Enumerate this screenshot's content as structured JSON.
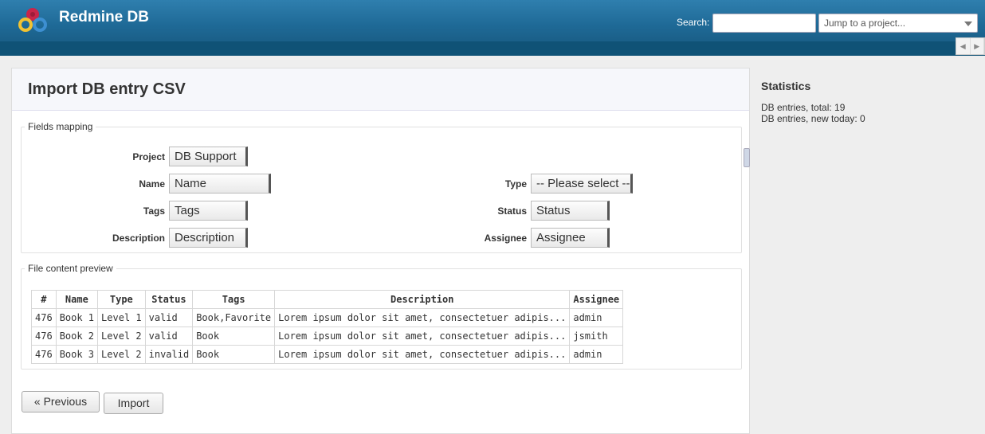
{
  "header": {
    "app_title": "Redmine DB",
    "search_label": "Search:",
    "search_value": "",
    "project_jump": "Jump to a project..."
  },
  "page": {
    "title": "Import DB entry CSV"
  },
  "mapping": {
    "legend": "Fields mapping",
    "left": [
      {
        "label": "Project",
        "value": "DB Support"
      },
      {
        "label": "Name",
        "value": "Name"
      },
      {
        "label": "Tags",
        "value": "Tags"
      },
      {
        "label": "Description",
        "value": "Description"
      }
    ],
    "right": [
      {
        "label": "Type",
        "value": "-- Please select --"
      },
      {
        "label": "Status",
        "value": "Status"
      },
      {
        "label": "Assignee",
        "value": "Assignee"
      }
    ]
  },
  "preview": {
    "legend": "File content preview",
    "columns": [
      "#",
      "Name",
      "Type",
      "Status",
      "Tags",
      "Description",
      "Assignee"
    ],
    "rows": [
      [
        "476",
        "Book 1",
        "Level 1",
        "valid",
        "Book,Favorite",
        "Lorem ipsum dolor sit amet, consectetuer adipis...",
        "admin"
      ],
      [
        "476",
        "Book 2",
        "Level 2",
        "valid",
        "Book",
        "Lorem ipsum dolor sit amet, consectetuer adipis...",
        "jsmith"
      ],
      [
        "476",
        "Book 3",
        "Level 2",
        "invalid",
        "Book",
        "Lorem ipsum dolor sit amet, consectetuer adipis...",
        "admin"
      ]
    ]
  },
  "buttons": {
    "previous": "« Previous",
    "import": "Import"
  },
  "sidebar": {
    "title": "Statistics",
    "lines": [
      "DB entries, total: 19",
      "DB entries, new today: 0"
    ]
  },
  "colors": {
    "header": "#2f7fae",
    "menu": "#0f5276"
  }
}
